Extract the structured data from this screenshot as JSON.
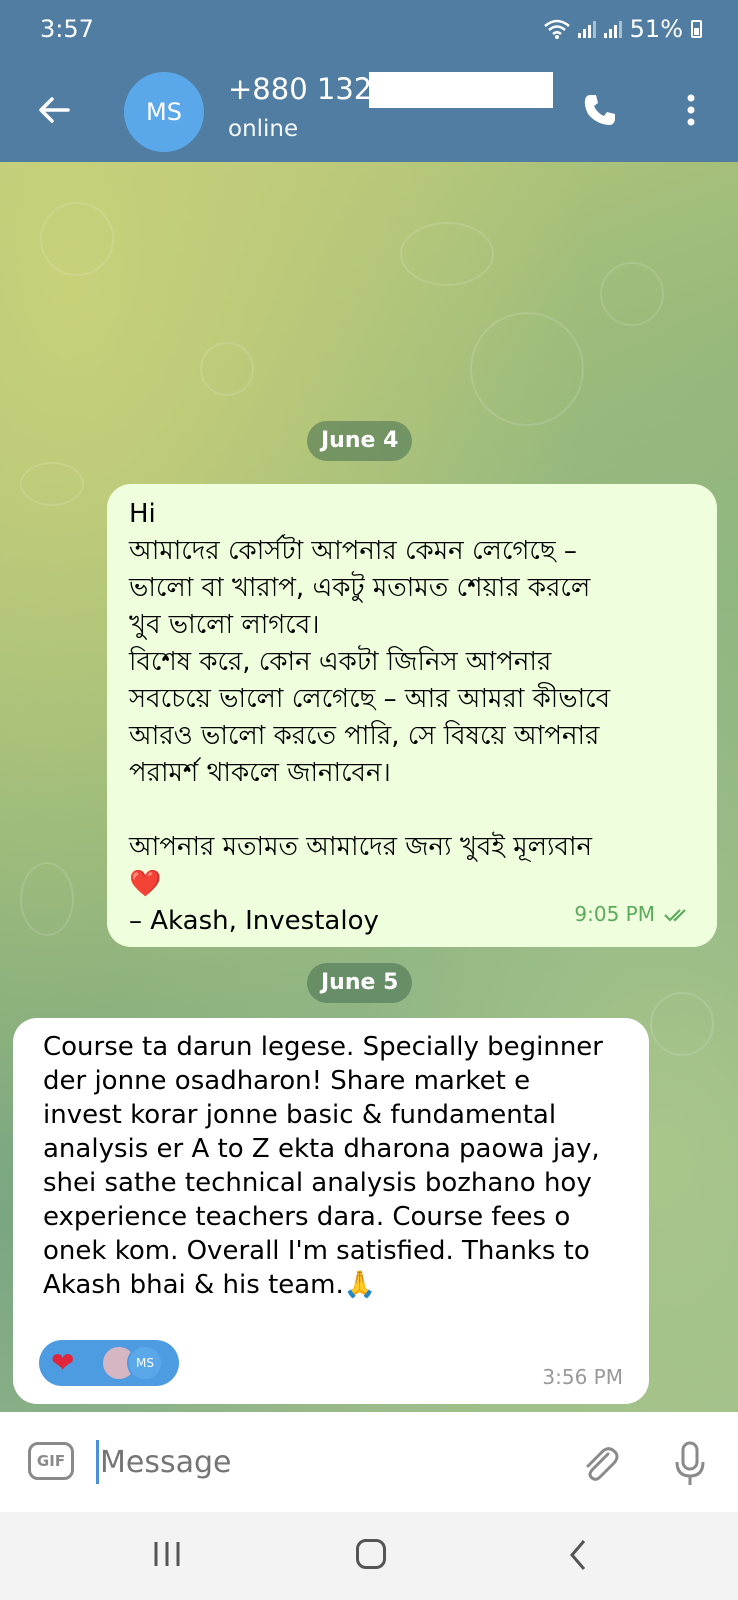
{
  "status": {
    "time": "3:57",
    "battery": "51%"
  },
  "header": {
    "title": "+880 132",
    "subtitle": "online",
    "avatar": "MS",
    "icons": [
      "back-arrow-icon",
      "phone-icon",
      "more-vertical-icon"
    ]
  },
  "messages": [
    {
      "date": "June 4",
      "direction": "outgoing",
      "text": "Hi\nআমাদের কোর্সটা আপনার কেমন লেগেছে –\nভালো বা খারাপ, একটু মতামত শেয়ার করলে\nখুব ভালো লাগবে।\nবিশেষ করে, কোন একটা জিনিস আপনার\nসবচেয়ে ভালো লেগেছে – আর আমরা কীভাবে\nআরও ভালো করতে পারি, সে বিষয়ে আপনার\nপরামর্শ থাকলে জানাবেন।\n\nআপনার মতামত আমাদের জন্য খুবই মূল্যবান\n❤️\n– Akash, Investaloy",
      "time": "9:05 PM",
      "read": true
    },
    {
      "date": "June 5",
      "direction": "incoming",
      "text": "Course ta darun legese. Specially beginner\nder jonne osadharon! Share market e\ninvest korar jonne basic & fundamental\nanalysis er A to Z ekta dharona paowa jay,\nshei sathe technical analysis bozhano hoy\nexperience teachers dara. Course fees o\nonek kom. Overall I'm satisfied. Thanks to\nAkash bhai & his team.🙏",
      "time": "3:56 PM",
      "reaction": {
        "emoji": "❤",
        "avatar_label": "MS"
      }
    }
  ],
  "composer": {
    "placeholder": "Message",
    "gif_label": "GIF"
  },
  "colors": {
    "header": "#517da2",
    "outgoing_bubble": "#effedd",
    "incoming_bubble": "#ffffff",
    "accent": "#5aa8ea"
  }
}
